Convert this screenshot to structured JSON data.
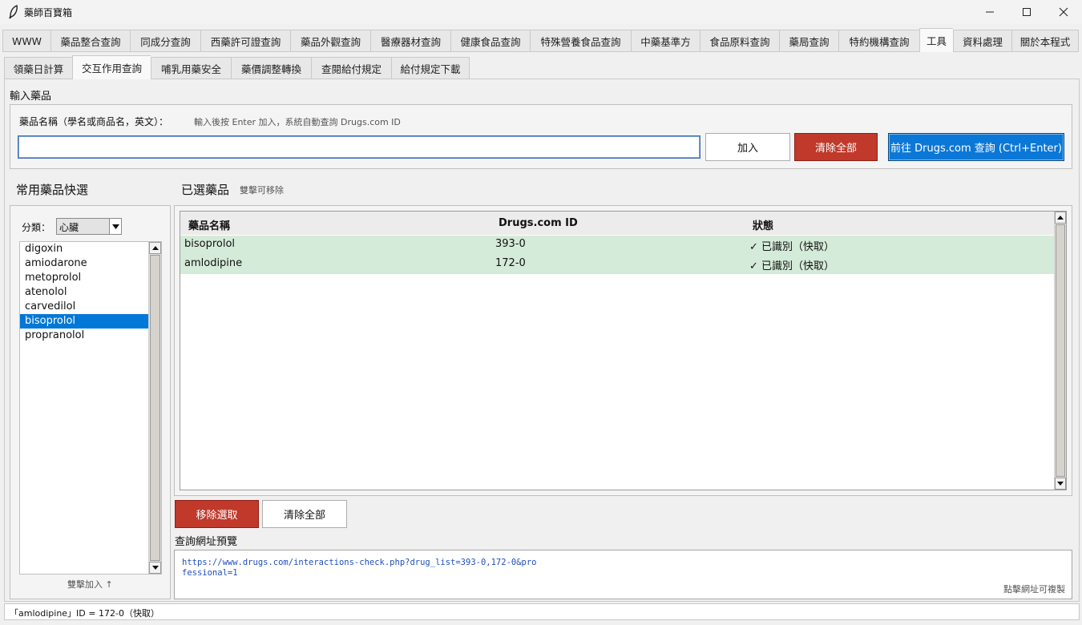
{
  "window": {
    "title": "藥師百寶箱"
  },
  "main_tabs": [
    {
      "label": "WWW",
      "active": false
    },
    {
      "label": "藥品整合查詢",
      "active": false
    },
    {
      "label": "同成分查詢",
      "active": false
    },
    {
      "label": "西藥許可證查詢",
      "active": false
    },
    {
      "label": "藥品外觀查詢",
      "active": false
    },
    {
      "label": "醫療器材查詢",
      "active": false
    },
    {
      "label": "健康食品查詢",
      "active": false
    },
    {
      "label": "特殊營養食品查詢",
      "active": false
    },
    {
      "label": "中藥基準方",
      "active": false
    },
    {
      "label": "食品原料查詢",
      "active": false
    },
    {
      "label": "藥局查詢",
      "active": false
    },
    {
      "label": "特約機構查詢",
      "active": false
    },
    {
      "label": "工具",
      "active": true
    },
    {
      "label": "資料處理",
      "active": false
    },
    {
      "label": "關於本程式",
      "active": false
    }
  ],
  "sub_tabs": [
    {
      "label": "領藥日計算",
      "active": false
    },
    {
      "label": "交互作用查詢",
      "active": true
    },
    {
      "label": "哺乳用藥安全",
      "active": false
    },
    {
      "label": "藥價調整轉換",
      "active": false
    },
    {
      "label": "查閱給付規定",
      "active": false
    },
    {
      "label": "給付規定下載",
      "active": false
    }
  ],
  "input_section": {
    "title": "輸入藥品",
    "field_label": "藥品名稱（學名或商品名，英文）：",
    "field_hint": "輸入後按 Enter 加入，系統自動查詢 Drugs.com ID",
    "value": "",
    "add_button": "加入",
    "clear_all_button": "清除全部",
    "go_button": "前往 Drugs.com 查詢 (Ctrl+Enter)"
  },
  "quick_pick": {
    "title": "常用藥品快選",
    "category_label": "分類：",
    "category_value": "心臟",
    "items": [
      "digoxin",
      "amiodarone",
      "metoprolol",
      "atenolol",
      "carvedilol",
      "bisoprolol",
      "propranolol"
    ],
    "selected_index": 5,
    "footer_hint": "雙擊加入 ↑"
  },
  "selected_drugs": {
    "title": "已選藥品",
    "hint": "雙擊可移除",
    "columns": [
      "藥品名稱",
      "Drugs.com ID",
      "狀態"
    ],
    "rows": [
      {
        "name": "bisoprolol",
        "id": "393-0",
        "status": "✓ 已識別（快取）"
      },
      {
        "name": "amlodipine",
        "id": "172-0",
        "status": "✓ 已識別（快取）"
      }
    ],
    "remove_button": "移除選取",
    "clear_button": "清除全部"
  },
  "url_preview": {
    "title": "查詢網址預覽",
    "line1": "https://www.drugs.com/interactions-check.php?drug_list=393-0,172-0&pro",
    "line2": "fessional=1",
    "copy_hint": "點擊網址可複製"
  },
  "status_bar": {
    "text": "「amlodipine」ID = 172-0（快取）"
  },
  "colors": {
    "accent_blue": "#0078d7",
    "danger_red": "#c0392b",
    "row_green": "#d5ebd9"
  }
}
